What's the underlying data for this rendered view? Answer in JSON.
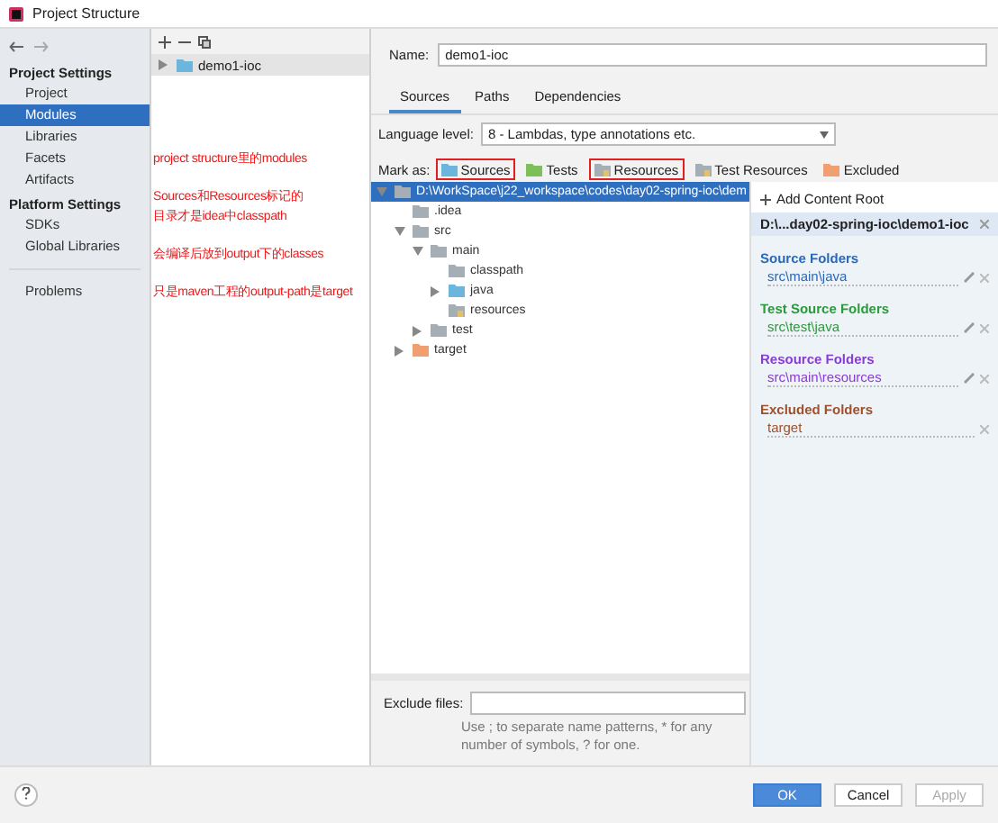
{
  "window": {
    "title": "Project Structure"
  },
  "sidebar": {
    "groups": [
      {
        "title": "Project Settings",
        "items": [
          {
            "label": "Project",
            "selected": false
          },
          {
            "label": "Modules",
            "selected": true
          },
          {
            "label": "Libraries",
            "selected": false
          },
          {
            "label": "Facets",
            "selected": false
          },
          {
            "label": "Artifacts",
            "selected": false
          }
        ]
      },
      {
        "title": "Platform Settings",
        "items": [
          {
            "label": "SDKs",
            "selected": false
          },
          {
            "label": "Global Libraries",
            "selected": false
          }
        ]
      },
      {
        "items": [
          {
            "label": "Problems",
            "selected": false
          }
        ]
      }
    ]
  },
  "modules": [
    {
      "label": "demo1-ioc",
      "selected": true
    }
  ],
  "annotations": [
    {
      "lines": [
        "project structure里的modules"
      ]
    },
    {
      "lines": [
        "Sources和Resources标记的",
        "目录才是idea中classpath"
      ]
    },
    {
      "lines": [
        "会编译后放到output下的classes"
      ]
    },
    {
      "lines": [
        "只是maven工程的output-path是target"
      ]
    }
  ],
  "name_field": {
    "label": "Name:",
    "value": "demo1-ioc"
  },
  "tabs": [
    {
      "label": "Sources",
      "selected": true
    },
    {
      "label": "Paths",
      "selected": false
    },
    {
      "label": "Dependencies",
      "selected": false
    }
  ],
  "language_level": {
    "label": "Language level:",
    "value": "8 - Lambdas, type annotations etc."
  },
  "mark_as": {
    "label": "Mark as:",
    "buttons": [
      {
        "label": "Sources",
        "kind": "source",
        "highlighted": true
      },
      {
        "label": "Tests",
        "kind": "test",
        "highlighted": false
      },
      {
        "label": "Resources",
        "kind": "resource",
        "highlighted": true
      },
      {
        "label": "Test Resources",
        "kind": "testresource",
        "highlighted": false
      },
      {
        "label": "Excluded",
        "kind": "excluded",
        "highlighted": false
      }
    ]
  },
  "tree": [
    {
      "label": "D:\\WorkSpace\\j22_workspace\\codes\\day02-spring-ioc\\dem",
      "kind": "plain",
      "leaf": false,
      "expanded": true,
      "selected": true,
      "children": [
        {
          "label": ".idea",
          "kind": "plain",
          "leaf": true,
          "selected": false
        },
        {
          "label": "src",
          "kind": "plain",
          "leaf": false,
          "expanded": true,
          "selected": false,
          "children": [
            {
              "label": "main",
              "kind": "plain",
              "leaf": false,
              "expanded": true,
              "selected": false,
              "children": [
                {
                  "label": "classpath",
                  "kind": "plain",
                  "leaf": true,
                  "selected": false
                },
                {
                  "label": "java",
                  "kind": "source",
                  "leaf": false,
                  "expanded": false,
                  "selected": false
                },
                {
                  "label": "resources",
                  "kind": "resource",
                  "leaf": true,
                  "selected": false
                }
              ]
            },
            {
              "label": "test",
              "kind": "plain",
              "leaf": false,
              "expanded": false,
              "selected": false
            }
          ]
        },
        {
          "label": "target",
          "kind": "excluded",
          "leaf": false,
          "expanded": false,
          "selected": false
        }
      ]
    }
  ],
  "exclude_files": {
    "label": "Exclude files:",
    "hint": "Use ; to separate name patterns, * for any number of symbols, ? for one."
  },
  "content_roots": {
    "add": "Add Content Root",
    "root": "D:\\...day02-spring-ioc\\demo1-ioc",
    "groups": [
      {
        "title": "Source Folders",
        "kind": "source",
        "entries": [
          {
            "path": "src\\main\\java",
            "editable": true
          }
        ]
      },
      {
        "title": "Test Source Folders",
        "kind": "test",
        "entries": [
          {
            "path": "src\\test\\java",
            "editable": true
          }
        ]
      },
      {
        "title": "Resource Folders",
        "kind": "resource",
        "entries": [
          {
            "path": "src\\main\\resources",
            "editable": true
          }
        ]
      },
      {
        "title": "Excluded Folders",
        "kind": "excluded",
        "entries": [
          {
            "path": "target",
            "editable": false
          }
        ]
      }
    ]
  },
  "buttons": [
    {
      "label": "OK",
      "kind": "primary",
      "disabled": false
    },
    {
      "label": "Cancel",
      "kind": "normal",
      "disabled": false
    },
    {
      "label": "Apply",
      "kind": "normal",
      "disabled": true
    }
  ]
}
